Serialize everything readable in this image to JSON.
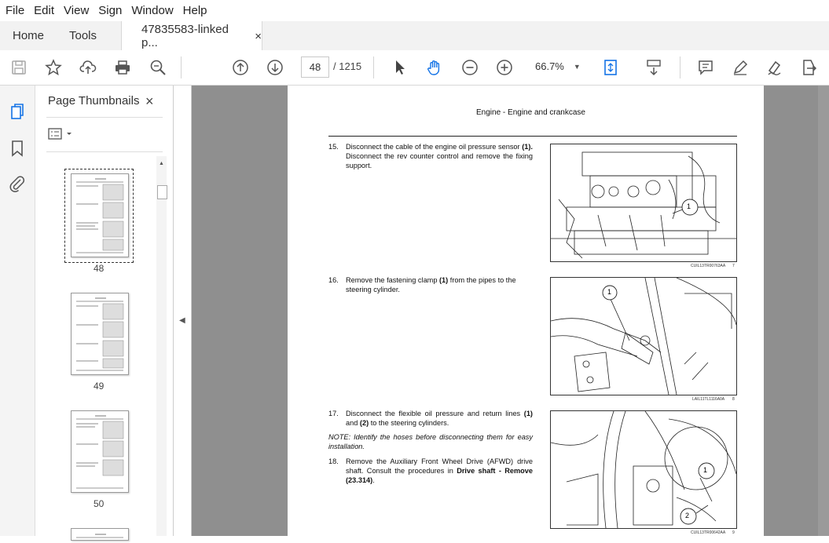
{
  "menu": [
    "File",
    "Edit",
    "View",
    "Sign",
    "Window",
    "Help"
  ],
  "tabs": {
    "home": "Home",
    "tools": "Tools",
    "doc": "47835583-linked p...",
    "close": "×"
  },
  "toolbar": {
    "page_current": "48",
    "page_total": "/ 1215",
    "zoom": "66.7%"
  },
  "panel": {
    "title": "Page Thumbnails",
    "close": "×"
  },
  "thumbnails": [
    {
      "label": "48"
    },
    {
      "label": "49"
    },
    {
      "label": "50"
    }
  ],
  "document": {
    "header": "Engine - Engine and crankcase",
    "step15_num": "15.",
    "step15_a": "Disconnect the cable of the engine oil pressure sensor",
    "step15_b": "(1).",
    "step15_c": "Disconnect the rev counter control and remove the fixing support.",
    "fig1_caption": "CUIL13TR00763AA",
    "fig1_num": "7",
    "step16_num": "16.",
    "step16_a": "Remove the fastening clamp",
    "step16_b": "(1)",
    "step16_c": "from the pipes to the steering cylinder.",
    "fig2_caption": "LAIL11TL1116A0A",
    "fig2_num": "8",
    "step17_num": "17.",
    "step17_a": "Disconnect the flexible oil pressure and return lines",
    "step17_b": "(1)",
    "step17_c": "and",
    "step17_d": "(2)",
    "step17_e": "to the steering cylinders.",
    "note": "NOTE: Identify the hoses before disconnecting them for easy installation.",
    "step18_num": "18.",
    "step18_a": "Remove the Auxiliary Front Wheel Drive (AFWD) drive shaft.  Consult the procedures in",
    "step18_b": "Drive shaft - Remove (23.314)",
    "step18_c": ".",
    "fig3_caption": "CUIL13TR00642AA",
    "fig3_num": "9",
    "callout_1": "1",
    "callout_2": "2"
  },
  "colors": {
    "accent": "#1473e6",
    "toolbar_bg": "#ffffff",
    "tabbar_bg": "#f2f2f2",
    "doc_bg": "#8f8f8f"
  },
  "icons": [
    "save-icon",
    "bookmark-star-icon",
    "upload-icon",
    "print-icon",
    "zoom-search-icon",
    "page-up-icon",
    "page-down-icon",
    "select-arrow-icon",
    "hand-icon",
    "zoom-out-icon",
    "zoom-in-icon",
    "fit-page-icon",
    "scroll-mode-icon",
    "comment-icon",
    "pen-icon",
    "sign-icon",
    "export-icon",
    "thumbnails-icon",
    "bookmarks-icon",
    "attachments-icon"
  ]
}
